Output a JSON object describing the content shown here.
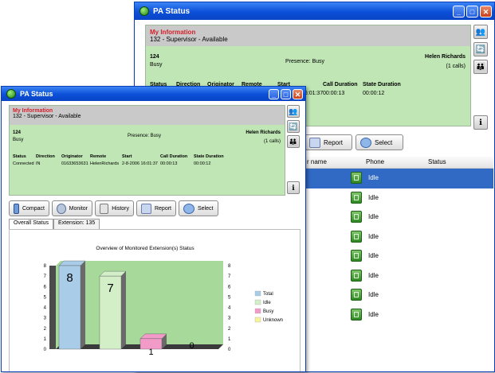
{
  "back_window": {
    "title": "PA Status",
    "my_info": {
      "label": "My Information",
      "status": "132 - Supervisor - Available",
      "ext": "124",
      "state": "Busy",
      "presence": "Presence: Busy",
      "name": "Helen Richards",
      "calls": "(1 calls)"
    },
    "call_headers": [
      "Status",
      "Direction",
      "Originator",
      "Remote",
      "Start",
      "Call Duration",
      "State Duration"
    ],
    "call_row": [
      "Connected",
      "IN",
      "01633653631",
      "HelenRichards",
      "2-8-2006 16:01:37",
      "00:00:13",
      "00:00:12"
    ],
    "toolbar": [
      {
        "label": "Report"
      },
      {
        "label": "Select"
      }
    ],
    "grid_headers": [
      "r name",
      "Phone",
      "Status"
    ],
    "grid_rows": [
      "Idle",
      "Idle",
      "Idle",
      "Idle",
      "Idle",
      "Idle",
      "Idle",
      "Idle"
    ]
  },
  "front_window": {
    "title": "PA Status",
    "my_info": {
      "label": "My Information",
      "status": "132 - Supervisor - Available",
      "ext": "124",
      "state": "Busy",
      "presence": "Presence: Busy",
      "name": "Helen Richards",
      "calls": "(1 calls)"
    },
    "call_headers": [
      "Status",
      "Direction",
      "Originator",
      "Remote",
      "Start",
      "Call Duration",
      "State Duration"
    ],
    "call_row": [
      "Connected",
      "IN",
      "01633653631",
      "HelenRichards",
      "2-8-2006 16:01:37",
      "00:00:13",
      "00:00:12"
    ],
    "toolbar": [
      {
        "label": "Compact"
      },
      {
        "label": "Monitor"
      },
      {
        "label": "History"
      },
      {
        "label": "Report"
      },
      {
        "label": "Select"
      }
    ],
    "tabs": [
      "Overall Status",
      "Extension: 135"
    ]
  },
  "chart_data": {
    "type": "bar",
    "title": "Overview of Monitored Extension(s) Status",
    "categories": [
      "Total",
      "Idle",
      "Busy",
      "Unknown"
    ],
    "values": [
      8,
      7,
      1,
      0
    ],
    "data_labels": [
      "8",
      "7",
      "1",
      "0"
    ],
    "colors": [
      "#a9cde8",
      "#d3efc8",
      "#f29bc9",
      "#f6f39a"
    ],
    "ylim": [
      0,
      8
    ],
    "yticks": [
      "0",
      "1",
      "2",
      "3",
      "4",
      "5",
      "6",
      "7",
      "8"
    ],
    "legend": "right",
    "legend_entries": [
      "Total",
      "Idle",
      "Busy",
      "Unknown"
    ]
  }
}
